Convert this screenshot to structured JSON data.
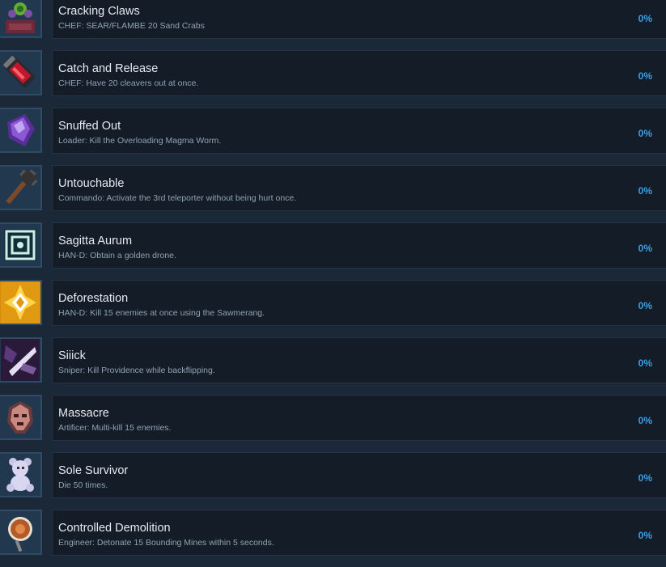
{
  "achievements": [
    {
      "icon": "flower-pot-icon",
      "title": "Cracking Claws",
      "description": "CHEF: SEAR/FLAMBE 20 Sand Crabs",
      "percent": "0%"
    },
    {
      "icon": "cleaver-canister-icon",
      "title": "Catch and Release",
      "description": "CHEF: Have 20 cleavers out at once.",
      "percent": "0%"
    },
    {
      "icon": "purple-crystal-icon",
      "title": "Snuffed Out",
      "description": "Loader: Kill the Overloading Magma Worm.",
      "percent": "0%"
    },
    {
      "icon": "spiked-club-icon",
      "title": "Untouchable",
      "description": "Commando: Activate the 3rd teleporter without being hurt once.",
      "percent": "0%"
    },
    {
      "icon": "drone-frame-icon",
      "title": "Sagitta Aurum",
      "description": "HAN-D: Obtain a golden drone.",
      "percent": "0%"
    },
    {
      "icon": "golden-sawmerang-icon",
      "title": "Deforestation",
      "description": "HAN-D: Kill 15 enemies at once using the Sawmerang.",
      "percent": "0%"
    },
    {
      "icon": "sniper-slash-icon",
      "title": "Siiick",
      "description": "Sniper: Kill Providence while backflipping.",
      "percent": "0%"
    },
    {
      "icon": "demon-mask-icon",
      "title": "Massacre",
      "description": "Artificer: Multi-kill 15 enemies.",
      "percent": "0%"
    },
    {
      "icon": "teddy-bear-icon",
      "title": "Sole Survivor",
      "description": "Die 50 times.",
      "percent": "0%"
    },
    {
      "icon": "mine-detonator-icon",
      "title": "Controlled Demolition",
      "description": "Engineer: Detonate 15 Bounding Mines within 5 seconds.",
      "percent": "0%"
    }
  ]
}
